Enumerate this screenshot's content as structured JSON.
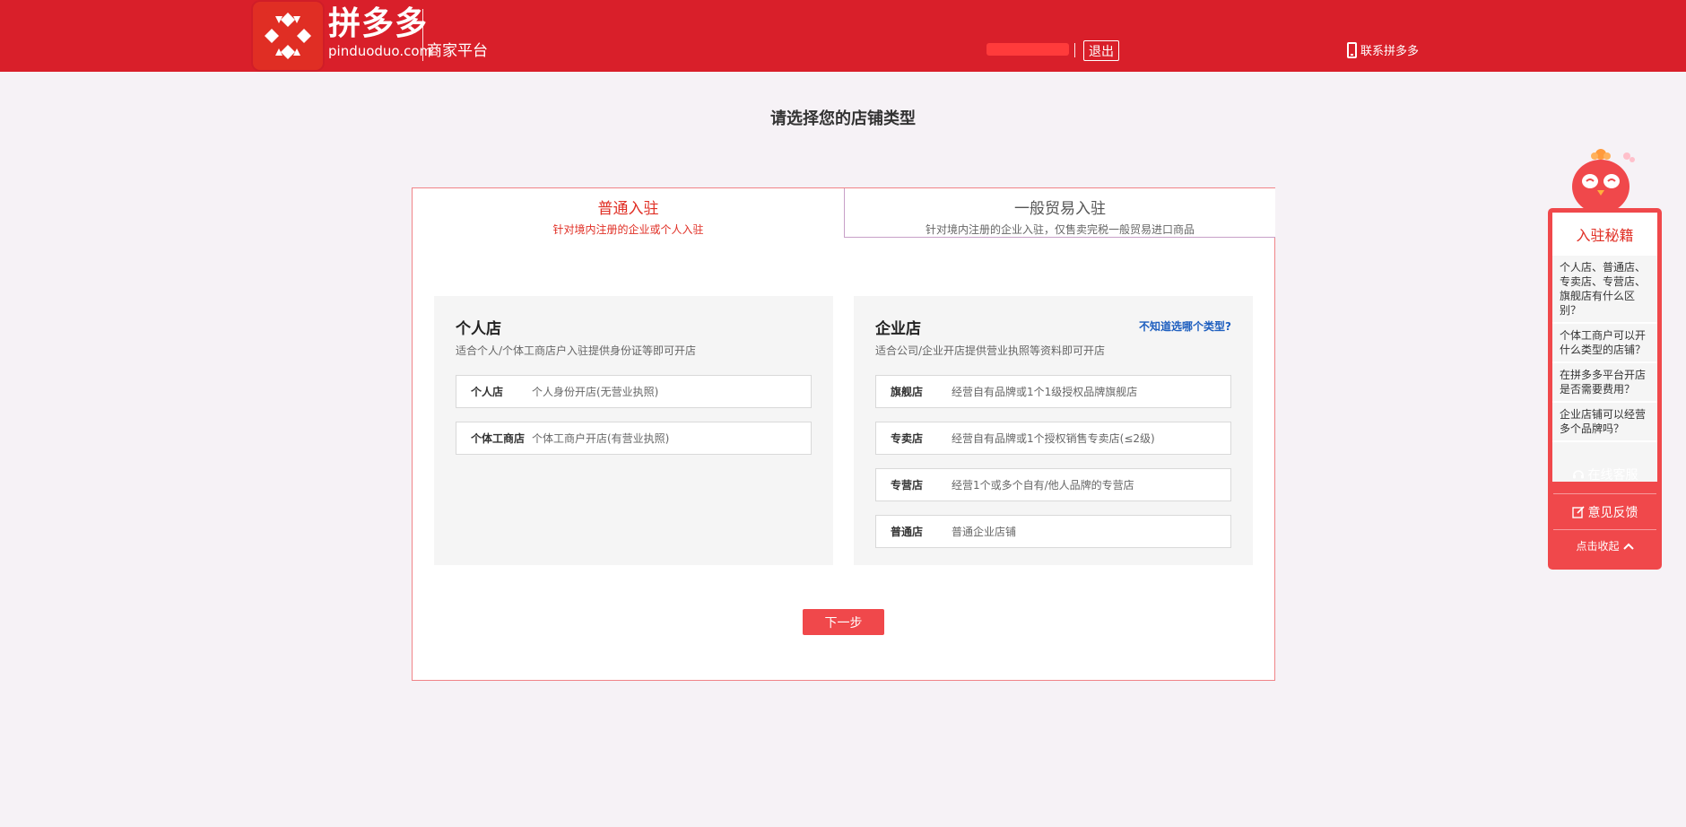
{
  "header": {
    "brand_cn": "拼多多",
    "brand_en": "pinduoduo.com",
    "logo_mark": "拼",
    "platform_label": "商家平台",
    "logout_label": "退出",
    "contact_label": "联系拼多多",
    "contact_icon": "phone-icon",
    "brand_color": "#d91f2a"
  },
  "page": {
    "title": "请选择您的店铺类型"
  },
  "tabs": [
    {
      "title": "普通入驻",
      "subtitle": "针对境内注册的企业或个人入驻",
      "active": true
    },
    {
      "title": "一般贸易入驻",
      "subtitle": "针对境内注册的企业入驻，仅售卖完税一般贸易进口商品",
      "active": false
    }
  ],
  "personal": {
    "title": "个人店",
    "desc": "适合个人/个体工商店户入驻提供身份证等即可开店",
    "options": [
      {
        "name": "个人店",
        "desc": "个人身份开店(无营业执照)"
      },
      {
        "name": "个体工商店",
        "desc": "个体工商户开店(有营业执照)"
      }
    ]
  },
  "enterprise": {
    "title": "企业店",
    "desc": "适合公司/企业开店提供营业执照等资料即可开店",
    "help_link": "不知道选哪个类型?",
    "options": [
      {
        "name": "旗舰店",
        "desc": "经营自有品牌或1个1级授权品牌旗舰店"
      },
      {
        "name": "专卖店",
        "desc": "经营自有品牌或1个授权销售专卖店(≤2级)"
      },
      {
        "name": "专营店",
        "desc": "经营1个或多个自有/他人品牌的专营店"
      },
      {
        "name": "普通店",
        "desc": "普通企业店铺"
      }
    ]
  },
  "actions": {
    "next_label": "下一步"
  },
  "side_panel": {
    "title": "入驻秘籍",
    "questions": [
      "个人店、普通店、专卖店、专营店、旗舰店有什么区别？",
      "个体工商户可以开什么类型的店铺？",
      "在拼多多平台开店是否需要费用？",
      "企业店铺可以经营多个品牌吗？"
    ],
    "online_service": "在线客服",
    "feedback": "意见反馈",
    "collapse": "点击收起",
    "accent_color": "#f0484b"
  }
}
